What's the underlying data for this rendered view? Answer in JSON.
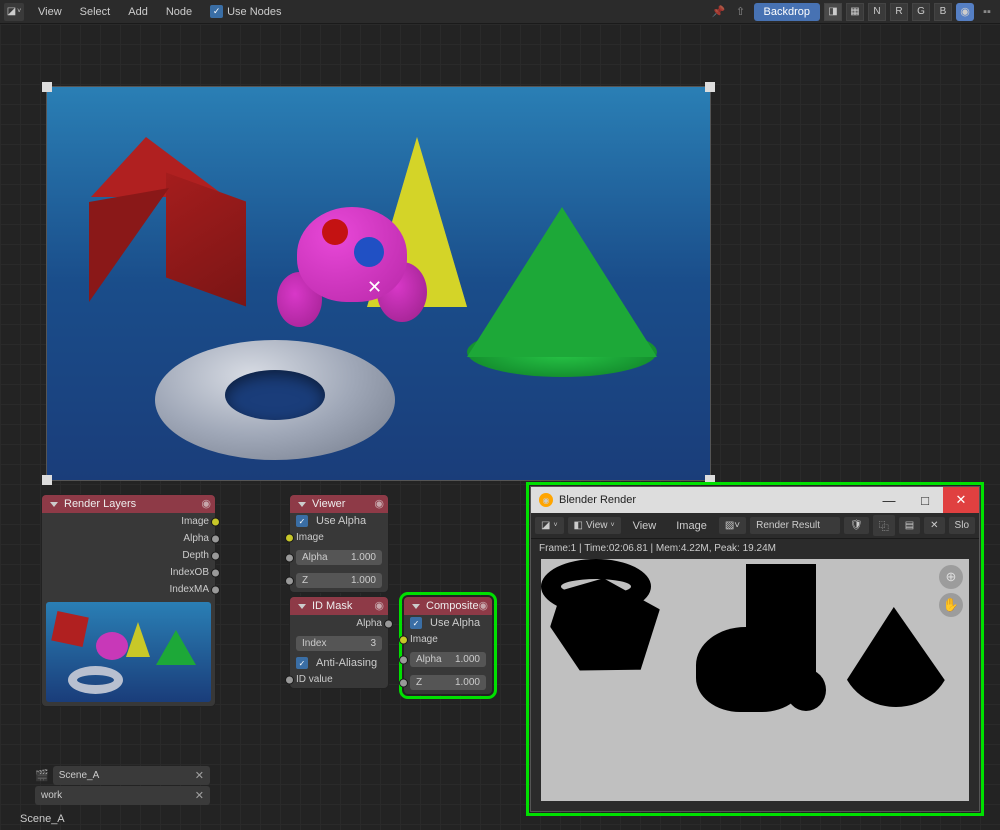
{
  "topbar": {
    "view": "View",
    "select": "Select",
    "add": "Add",
    "node": "Node",
    "use_nodes": "Use Nodes",
    "backdrop": "Backdrop",
    "channels": [
      "N",
      "R",
      "G",
      "B"
    ]
  },
  "nodes": {
    "render_layers": {
      "title": "Render Layers",
      "outputs": [
        "Image",
        "Alpha",
        "Depth",
        "IndexOB",
        "IndexMA"
      ]
    },
    "viewer": {
      "title": "Viewer",
      "use_alpha": "Use Alpha",
      "image": "Image",
      "alpha_label": "Alpha",
      "alpha_val": "1.000",
      "z_label": "Z",
      "z_val": "1.000"
    },
    "id_mask": {
      "title": "ID Mask",
      "alpha": "Alpha",
      "index_label": "Index",
      "index_val": "3",
      "anti_aliasing": "Anti-Aliasing",
      "id_value": "ID value"
    },
    "composite": {
      "title": "Composite",
      "use_alpha": "Use Alpha",
      "image": "Image",
      "alpha_label": "Alpha",
      "alpha_val": "1.000",
      "z_label": "Z",
      "z_val": "1.000"
    }
  },
  "render_window": {
    "title": "Blender Render",
    "view_menu": "View",
    "view_label": "View",
    "image_label": "Image",
    "render_result": "Render Result",
    "slot": "Slo",
    "status": "Frame:1 | Time:02:06.81 | Mem:4.22M, Peak: 19.24M"
  },
  "footer": {
    "scene": "Scene_A",
    "work": "work",
    "scene_label": "Scene_A"
  }
}
